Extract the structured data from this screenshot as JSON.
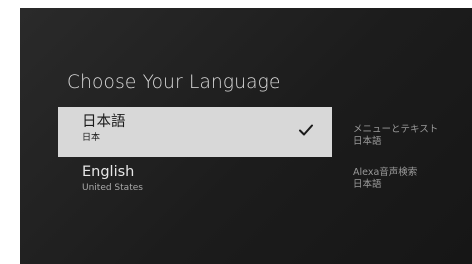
{
  "title": "Choose Your Language",
  "languages": [
    {
      "name": "日本語",
      "region": "日本",
      "selected": true
    },
    {
      "name": "English",
      "region": "United States",
      "selected": false
    }
  ],
  "side_info": {
    "menu_label": "メニューとテキスト",
    "menu_value": "日本語",
    "alexa_label": "Alexa音声検索",
    "alexa_value": "日本語"
  },
  "icons": {
    "selected_marker": "checkmark-icon"
  },
  "colors": {
    "background": "#1c1c1c",
    "selected_bg": "#d8d8d8",
    "text_primary": "#e6e6e6",
    "text_secondary": "#9a9a9a"
  }
}
